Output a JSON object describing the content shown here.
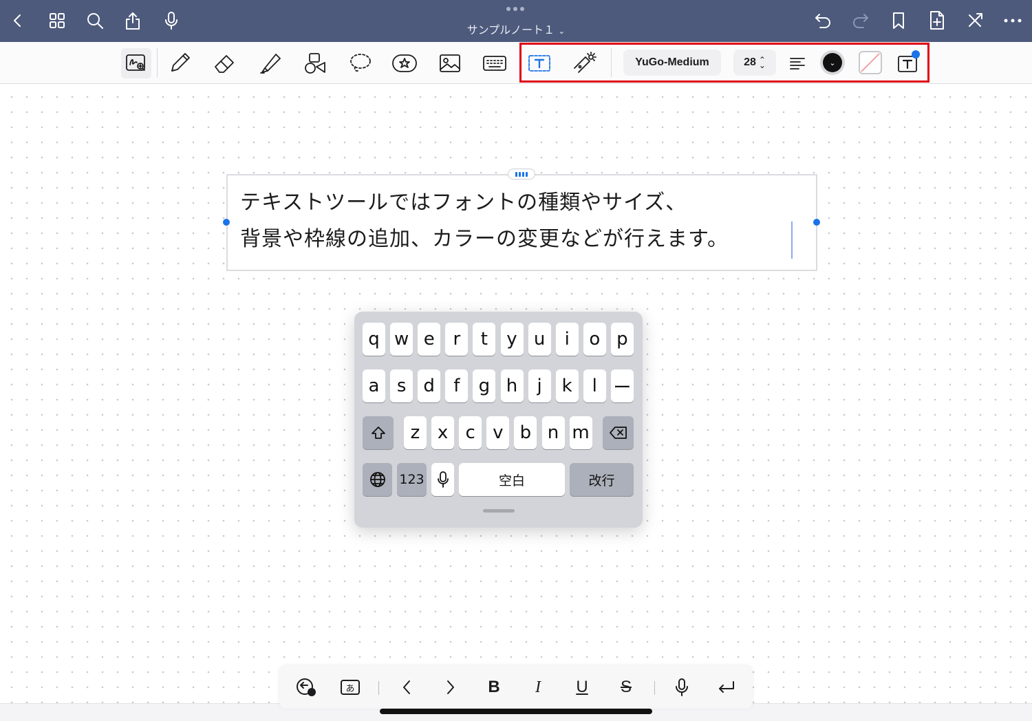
{
  "header": {
    "title": "サンプルノート１",
    "icons": [
      "back-icon",
      "grid-icon",
      "search-icon",
      "share-icon",
      "microphone-icon",
      "undo-icon",
      "redo-icon",
      "bookmark-icon",
      "add-page-icon",
      "close-x-icon",
      "more-icon"
    ]
  },
  "toolbar": {
    "tools": [
      "handwriting-add-icon",
      "pen-icon",
      "eraser-icon",
      "highlighter-icon",
      "shapes-icon",
      "lasso-icon",
      "sticker-icon",
      "image-icon",
      "keyboard-icon",
      "text-tool-icon",
      "laser-pointer-icon"
    ],
    "font_name": "YuGo-Medium",
    "font_size": "28",
    "text_color": "#111111",
    "highlight_color": "#e00012",
    "accent_color": "#1a73e8"
  },
  "textbox": {
    "line1": "テキストツールではフォントの種類やサイズ、",
    "line2": "背景や枠線の追加、カラーの変更などが行えます。"
  },
  "keyboard": {
    "row1": [
      "q",
      "w",
      "e",
      "r",
      "t",
      "y",
      "u",
      "i",
      "o",
      "p"
    ],
    "row2": [
      "a",
      "s",
      "d",
      "f",
      "g",
      "h",
      "j",
      "k",
      "l",
      "ー"
    ],
    "row3": [
      "z",
      "x",
      "c",
      "v",
      "b",
      "n",
      "m"
    ],
    "numbers_label": "123",
    "space_label": "空白",
    "return_label": "改行"
  },
  "formatbar": {
    "kana_label": "あ",
    "bold_label": "B",
    "italic_label": "I",
    "underline_label": "U",
    "strike_label": "S"
  }
}
